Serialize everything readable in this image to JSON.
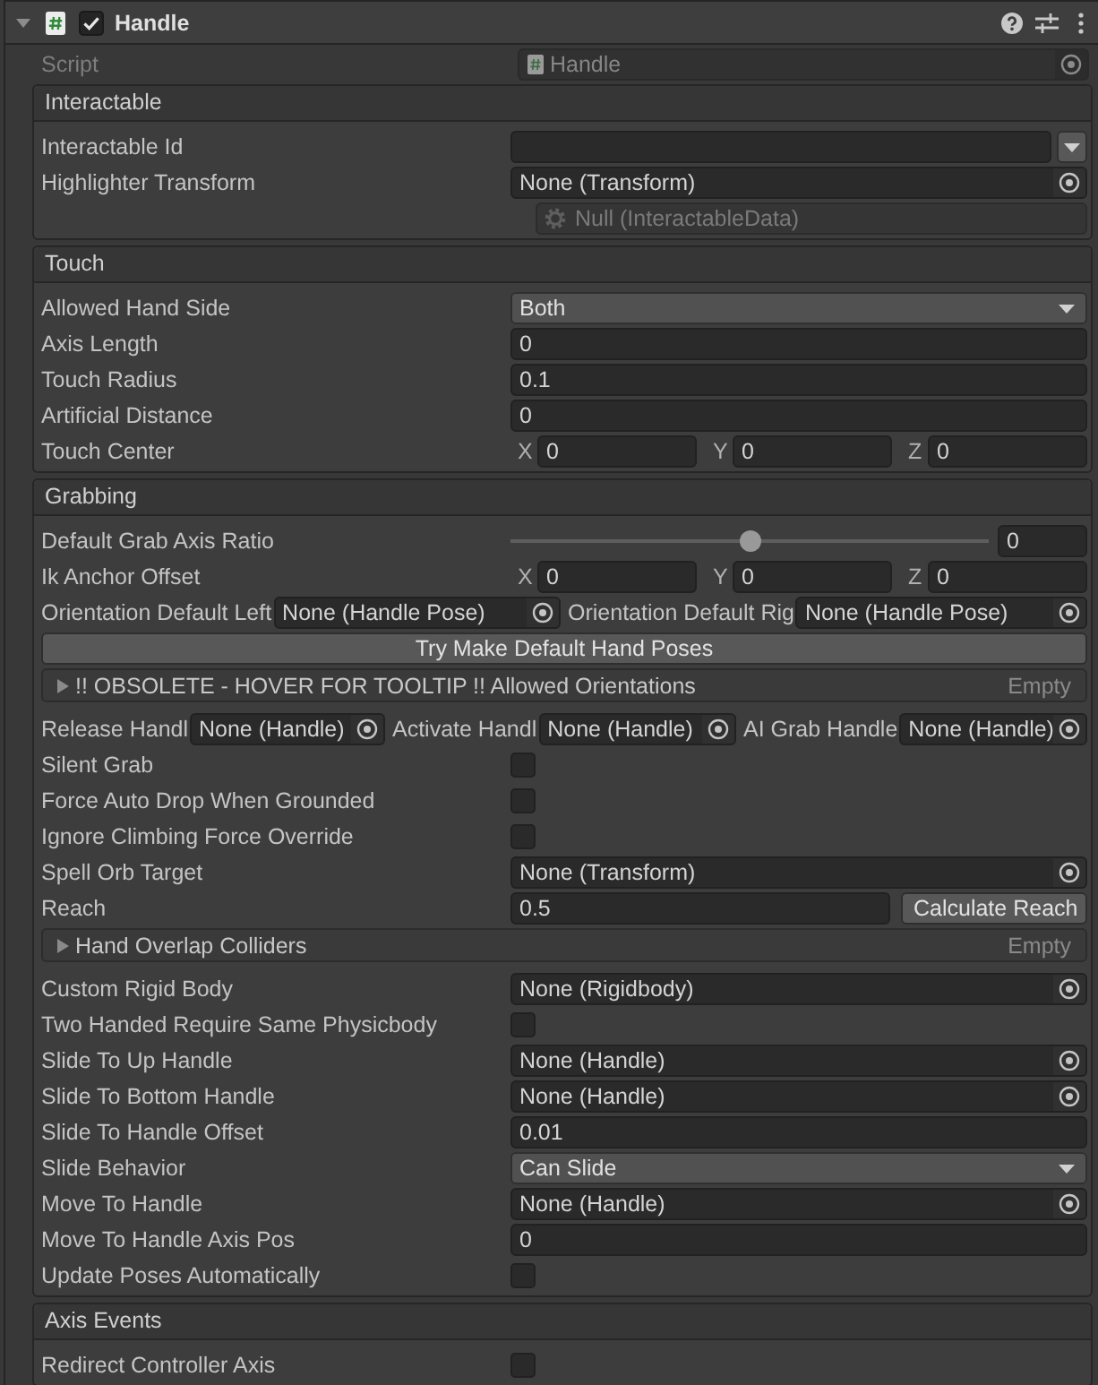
{
  "component": {
    "title": "Handle",
    "enabled": true,
    "expanded": true
  },
  "script": {
    "label": "Script",
    "value": "Handle",
    "disabled": true
  },
  "sections": [
    {
      "title": "Interactable",
      "rows": [
        {
          "kind": "text_dropdown",
          "label": "Interactable Id"
        },
        {
          "kind": "object",
          "label": "Highlighter Transform",
          "value": "None (Transform)"
        },
        {
          "kind": "sub_object",
          "value": "Null (InteractableData)"
        }
      ]
    },
    {
      "title": "Touch",
      "rows": [
        {
          "kind": "dropdown",
          "label": "Allowed Hand Side",
          "value": "Both"
        },
        {
          "kind": "number",
          "label": "Axis Length",
          "value": "0"
        },
        {
          "kind": "number",
          "label": "Touch Radius",
          "value": "0.1"
        },
        {
          "kind": "number",
          "label": "Artificial Distance",
          "value": "0"
        },
        {
          "kind": "vector3",
          "label": "Touch Center",
          "axes": [
            {
              "axis": "X",
              "value": "0"
            },
            {
              "axis": "Y",
              "value": "0"
            },
            {
              "axis": "Z",
              "value": "0"
            }
          ]
        }
      ]
    },
    {
      "title": "Grabbing",
      "rows": [
        {
          "kind": "slider",
          "label": "Default Grab Axis Ratio",
          "level": 0.5,
          "value": "0"
        },
        {
          "kind": "vector3",
          "label": "Ik Anchor Offset",
          "axes": [
            {
              "axis": "X",
              "value": "0"
            },
            {
              "axis": "Y",
              "value": "0"
            },
            {
              "axis": "Z",
              "value": "0"
            }
          ]
        },
        {
          "kind": "object_group",
          "fields": [
            {
              "label": "Orientation Default Left",
              "value": "None (Handle Pose)"
            },
            {
              "label": "Orientation Default Rig",
              "value": "None (Handle Pose)"
            }
          ]
        },
        {
          "kind": "button",
          "label": "Try Make Default Hand Poses"
        },
        {
          "kind": "foldout",
          "label": "!! OBSOLETE - HOVER FOR TOOLTIP !! Allowed Orientations",
          "expanded": false,
          "status": "Empty"
        },
        {
          "kind": "object_group",
          "fields": [
            {
              "label": "Release Handl",
              "value": "None (Handle)"
            },
            {
              "label": "Activate Handl",
              "value": "None (Handle)"
            },
            {
              "label": "AI Grab Handle",
              "value": "None (Handle)"
            }
          ]
        },
        {
          "kind": "checkbox",
          "label": "Silent Grab",
          "checked": false
        },
        {
          "kind": "checkbox",
          "label": "Force Auto Drop When Grounded",
          "checked": false
        },
        {
          "kind": "checkbox",
          "label": "Ignore Climbing Force Override",
          "checked": false
        },
        {
          "kind": "object",
          "label": "Spell Orb Target",
          "value": "None (Transform)"
        },
        {
          "kind": "number_button",
          "label": "Reach",
          "value": "0.5",
          "button": "Calculate Reach"
        },
        {
          "kind": "foldout",
          "label": "Hand Overlap Colliders",
          "expanded": false,
          "status": "Empty"
        },
        {
          "kind": "object",
          "label": "Custom Rigid Body",
          "value": "None (Rigidbody)"
        },
        {
          "kind": "checkbox",
          "label": "Two Handed Require Same Physicbody",
          "checked": false
        },
        {
          "kind": "object",
          "label": "Slide To Up Handle",
          "value": "None (Handle)"
        },
        {
          "kind": "object",
          "label": "Slide To Bottom Handle",
          "value": "None (Handle)"
        },
        {
          "kind": "number",
          "label": "Slide To Handle Offset",
          "value": "0.01"
        },
        {
          "kind": "dropdown",
          "label": "Slide Behavior",
          "value": "Can Slide"
        },
        {
          "kind": "object",
          "label": "Move To Handle",
          "value": "None (Handle)"
        },
        {
          "kind": "number",
          "label": "Move To Handle Axis Pos",
          "value": "0"
        },
        {
          "kind": "checkbox",
          "label": "Update Poses Automatically",
          "checked": false
        }
      ]
    },
    {
      "title": "Axis Events",
      "rows": [
        {
          "kind": "checkbox",
          "label": "Redirect Controller Axis",
          "checked": false
        }
      ]
    }
  ]
}
